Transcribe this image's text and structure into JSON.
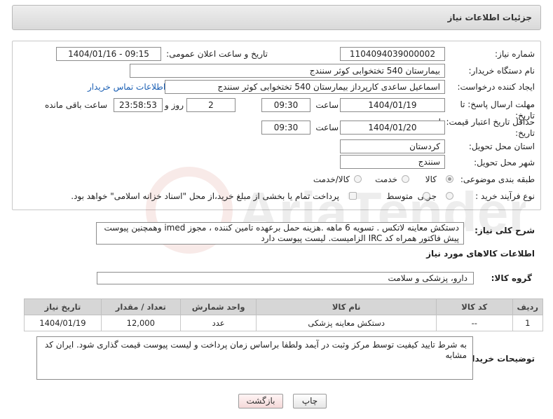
{
  "header": {
    "title": "جزئیات اطلاعات نیاز"
  },
  "fields": {
    "need_number_label": "شماره نیاز:",
    "need_number": "1104094039000002",
    "announce_label": "تاریخ و ساعت اعلان عمومی:",
    "announce_value": "1404/01/16 - 09:15",
    "buyer_org_label": "نام دستگاه خریدار:",
    "buyer_org": "بیمارستان 540 تختخوابی کوثر سنندج",
    "creator_label": "ایجاد کننده درخواست:",
    "creator": "اسماعیل ساعدی کارپرداز بیمارستان 540 تختخوابی کوثر سنندج",
    "contact_link": "اطلاعات تماس خریدار",
    "deadline_label": "مهلت ارسال پاسخ: تا تاریخ:",
    "deadline_date": "1404/01/19",
    "time_label": "ساعت",
    "deadline_time": "09:30",
    "days_value": "2",
    "days_label": "روز و",
    "remaining_time": "23:58:53",
    "remaining_label": "ساعت باقی مانده",
    "validity_label": "حداقل تاریخ اعتبار قیمت: تا تاریخ:",
    "validity_date": "1404/01/20",
    "validity_time": "09:30",
    "province_label": "استان محل تحویل:",
    "province": "کردستان",
    "city_label": "شهر محل تحویل:",
    "city": "سنندج",
    "category_label": "طبقه بندی موضوعی:",
    "category_options": [
      "کالا",
      "خدمت",
      "کالا/خدمت"
    ],
    "category_selected": "کالا",
    "process_label": "نوع فرآیند خرید :",
    "process_options": [
      "جزیی",
      "متوسط"
    ],
    "payment_note": "پرداخت تمام یا بخشی از مبلغ خرید،از محل \"اسناد خزانه اسلامی\" خواهد بود."
  },
  "description": {
    "label": "شرح کلی نیاز:",
    "text": "دستکش معاینه لاتکس . تسویه 6 ماهه .هزینه حمل برعهده تامین کننده ، مجوز imed وهمچنین پیوست پیش فاکتور همراه کد IRC  الزامیست. لیست پیوست دارد"
  },
  "goods": {
    "section_title": "اطلاعات کالاهای مورد نیاز",
    "group_label": "گروه کالا:",
    "group_value": "دارو، پزشکی و سلامت",
    "columns": [
      "ردیف",
      "کد کالا",
      "نام کالا",
      "واحد شمارش",
      "تعداد / مقدار",
      "تاریخ نیاز"
    ],
    "rows": [
      {
        "row": "1",
        "code": "--",
        "name": "دستکش معاینه پزشکی",
        "unit": "عدد",
        "qty": "12,000",
        "date": "1404/01/19"
      }
    ]
  },
  "buyer_notes": {
    "label": "توضیحات خریدار:",
    "text": "به شرط تایید کیفیت توسط مرکز وثبت در آیمد ولطفا براساس زمان پرداخت  و لیست پیوست قیمت گذاری شود. ایران کد مشابه"
  },
  "buttons": {
    "print": "چاپ",
    "back": "بازگشت"
  },
  "watermark_text": "AriaTender.net"
}
